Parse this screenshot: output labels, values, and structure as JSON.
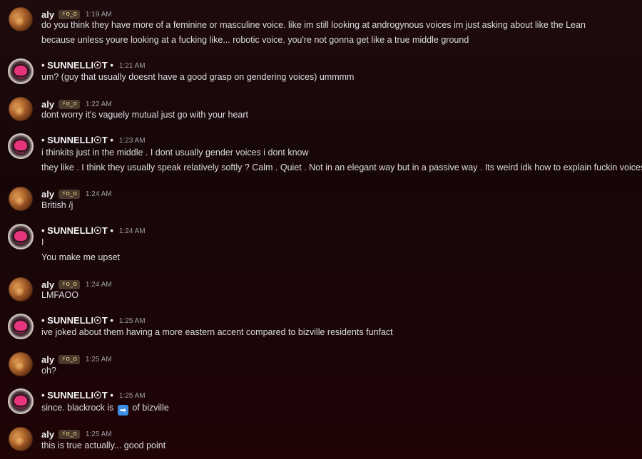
{
  "messages": [
    {
      "author": "aly",
      "tag": "⚡o_o",
      "time": "1:19 AM",
      "lines": [
        "do you think they have more of a feminine or masculine voice. like im still looking at androgynous voices im just asking about like the Lean",
        "because unless youre looking at a fucking like... robotic voice. you're not gonna get like a true middle ground"
      ]
    },
    {
      "author": "• SUNNELLI☉T •",
      "time": "1:21 AM",
      "lines": [
        "um? (guy that usually doesnt have a good grasp on gendering voices) ummmm"
      ]
    },
    {
      "author": "aly",
      "tag": "⚡o_o",
      "time": "1:22 AM",
      "lines": [
        "dont worry it's vaguely mutual just go with your heart"
      ]
    },
    {
      "author": "• SUNNELLI☉T •",
      "time": "1:23 AM",
      "lines": [
        "i thinkits just in the middle . I dont usually gender voices i dont know",
        "they like . I think they usually speak relatively softly ? Calm . Quiet . Not in an elegant way but in a passive way . Its weird idk how to explain fuckin voices"
      ]
    },
    {
      "author": "aly",
      "tag": "⚡o_o",
      "time": "1:24 AM",
      "lines": [
        "British /j"
      ]
    },
    {
      "author": "• SUNNELLI☉T •",
      "time": "1:24 AM",
      "lines": [
        "I",
        "You make me upset"
      ]
    },
    {
      "author": "aly",
      "tag": "⚡o_o",
      "time": "1:24 AM",
      "lines": [
        "LMFAOO"
      ]
    },
    {
      "author": "• SUNNELLI☉T •",
      "time": "1:25 AM",
      "lines": [
        "ive joked about them having a more eastern accent compared to bizville residents funfact"
      ]
    },
    {
      "author": "aly",
      "tag": "⚡o_o",
      "time": "1:25 AM",
      "lines": [
        "oh?"
      ]
    },
    {
      "author": "• SUNNELLI☉T •",
      "time": "1:25 AM",
      "line_parts": {
        "before": "since. blackrock is",
        "emoji": "➡",
        "after": "of bizville"
      }
    },
    {
      "author": "aly",
      "tag": "⚡o_o",
      "time": "1:25 AM",
      "lines": [
        "this is true actually... good point"
      ]
    }
  ]
}
